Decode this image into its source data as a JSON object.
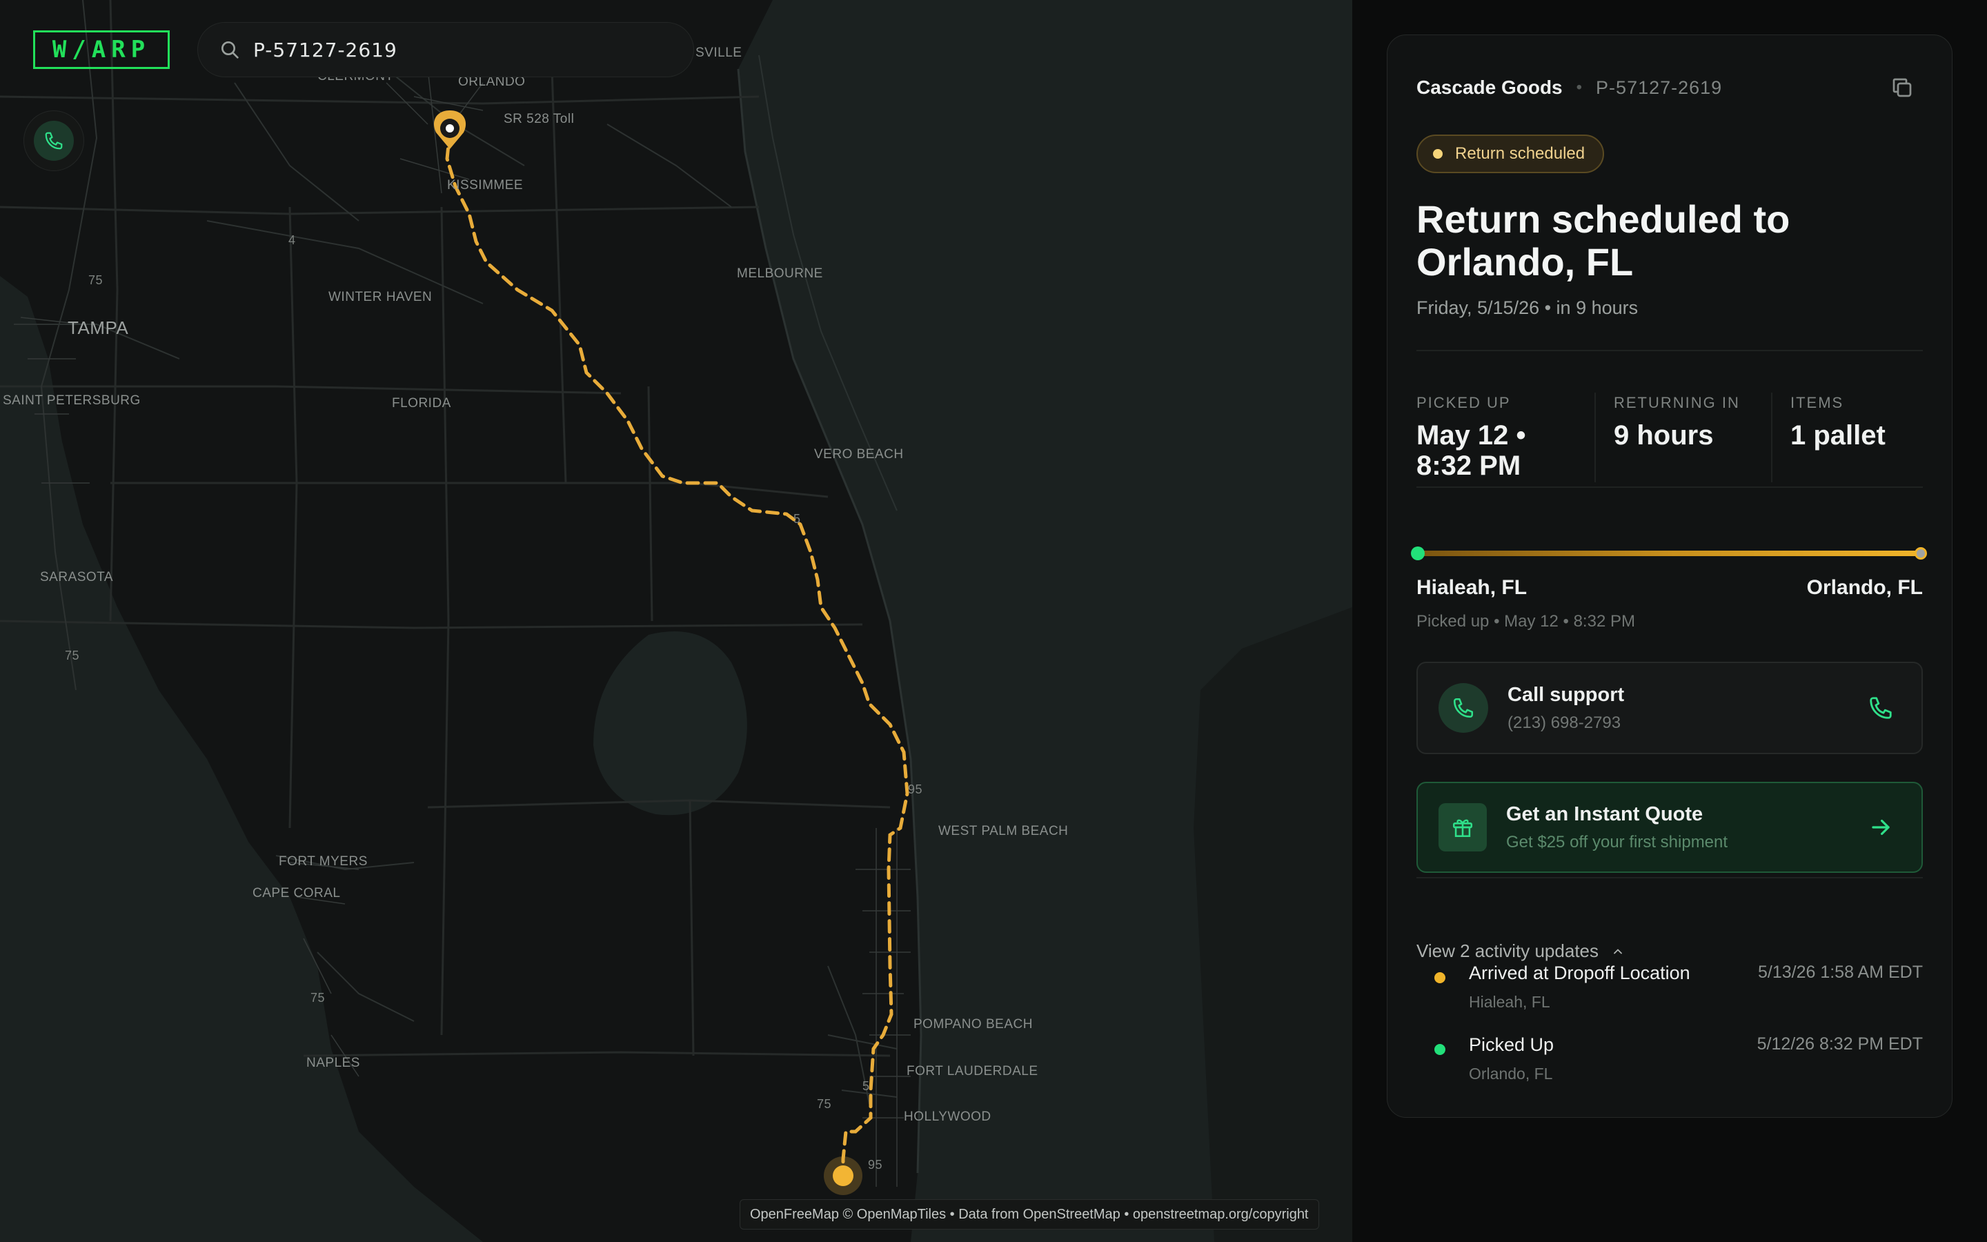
{
  "app": {
    "logo_text": "W/ARP",
    "brand_color": "#22e05a"
  },
  "search": {
    "value": "P-57127-2619",
    "icon": "search-icon"
  },
  "map": {
    "labels": {
      "clermont": "CLERMONT",
      "orlando": "ORLANDO",
      "sr528": "SR 528 Toll",
      "sville": "SVILLE",
      "kissimmee": "KISSIMMEE",
      "tampa": "TAMPA",
      "winter_haven": "WINTER HAVEN",
      "melbourne": "MELBOURNE",
      "st_pete": "SAINT PETERSBURG",
      "florida": "FLORIDA",
      "vero": "VERO BEACH",
      "sarasota": "SARASOTA",
      "wpb": "WEST PALM BEACH",
      "fort_myers": "FORT MYERS",
      "cape_coral": "CAPE CORAL",
      "naples": "NAPLES",
      "pompano": "POMPANO BEACH",
      "fort_laud": "FORT LAUDERDALE",
      "hollywood": "HOLLYWOOD",
      "r4": "4",
      "r75a": "75",
      "r75b": "75",
      "r75c": "75",
      "r75d": "75",
      "r95a": "95",
      "r95b": "95",
      "r5a": "5",
      "r5b": "5"
    },
    "route_color": "#e8ac3a",
    "attribution": "OpenFreeMap © OpenMapTiles • Data from OpenStreetMap • openstreetmap.org/copyright"
  },
  "shipment": {
    "company": "Cascade Goods",
    "separator": "•",
    "id": "P-57127-2619",
    "status_badge": "Return scheduled",
    "status_color": "#f5d47a",
    "title": "Return scheduled to Orlando, FL",
    "subtitle": "Friday, 5/15/26 • in 9 hours",
    "stats": [
      {
        "label": "PICKED UP",
        "value": "May 12 • 8:32 PM"
      },
      {
        "label": "RETURNING IN",
        "value": "9 hours"
      },
      {
        "label": "ITEMS",
        "value": "1 pallet"
      }
    ],
    "progress": 1.0,
    "from": "Hialeah, FL",
    "to": "Orlando, FL",
    "from_sub": "Picked up • May 12 • 8:32 PM"
  },
  "support": {
    "title": "Call support",
    "phone": "(213) 698-2793"
  },
  "quote": {
    "title": "Get an Instant Quote",
    "subtitle": "Get $25 off your first shipment"
  },
  "activity": {
    "toggle_label": "View 2 activity updates",
    "items": [
      {
        "name": "Arrived at Dropoff Location",
        "location": "Hialeah, FL",
        "time": "5/13/26 1:58 AM EDT",
        "color": "#f0b42a"
      },
      {
        "name": "Picked Up",
        "location": "Orlando, FL",
        "time": "5/12/26 8:32 PM EDT",
        "color": "#22e07a"
      }
    ]
  }
}
